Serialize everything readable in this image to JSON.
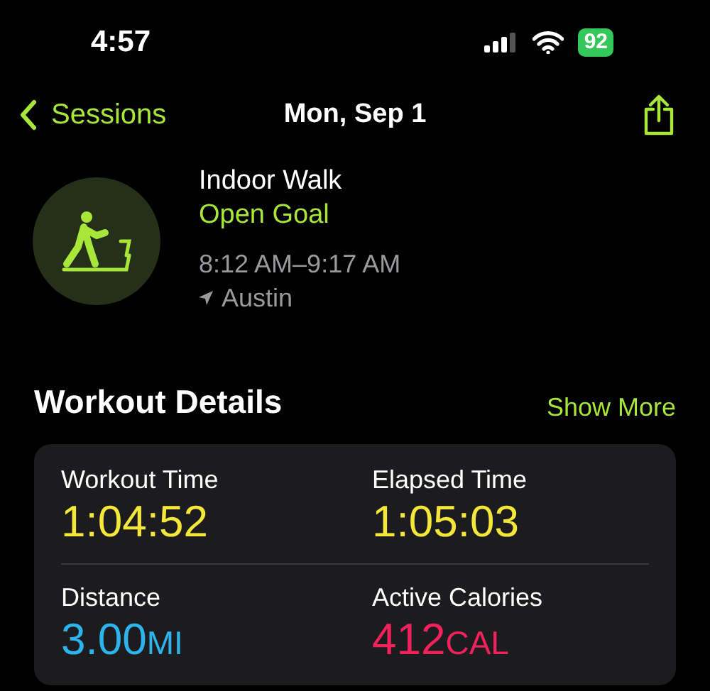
{
  "status_bar": {
    "time": "4:57",
    "battery": "92"
  },
  "nav": {
    "back": "Sessions",
    "title": "Mon, Sep 1"
  },
  "workout": {
    "name": "Indoor Walk",
    "goal": "Open Goal",
    "time_range": "8:12 AM–9:17 AM",
    "location": "Austin"
  },
  "details": {
    "title": "Workout Details",
    "action": "Show More",
    "metrics": [
      {
        "label": "Workout Time",
        "value": "1:04:52",
        "color": "#f5e63a"
      },
      {
        "label": "Elapsed Time",
        "value": "1:05:03",
        "color": "#f5e63a"
      },
      {
        "label": "Distance",
        "value": "3.00",
        "unit": "MI",
        "color": "#2eb4ec"
      },
      {
        "label": "Active Calories",
        "value": "412",
        "unit": "CAL",
        "color": "#f0215b"
      }
    ]
  }
}
